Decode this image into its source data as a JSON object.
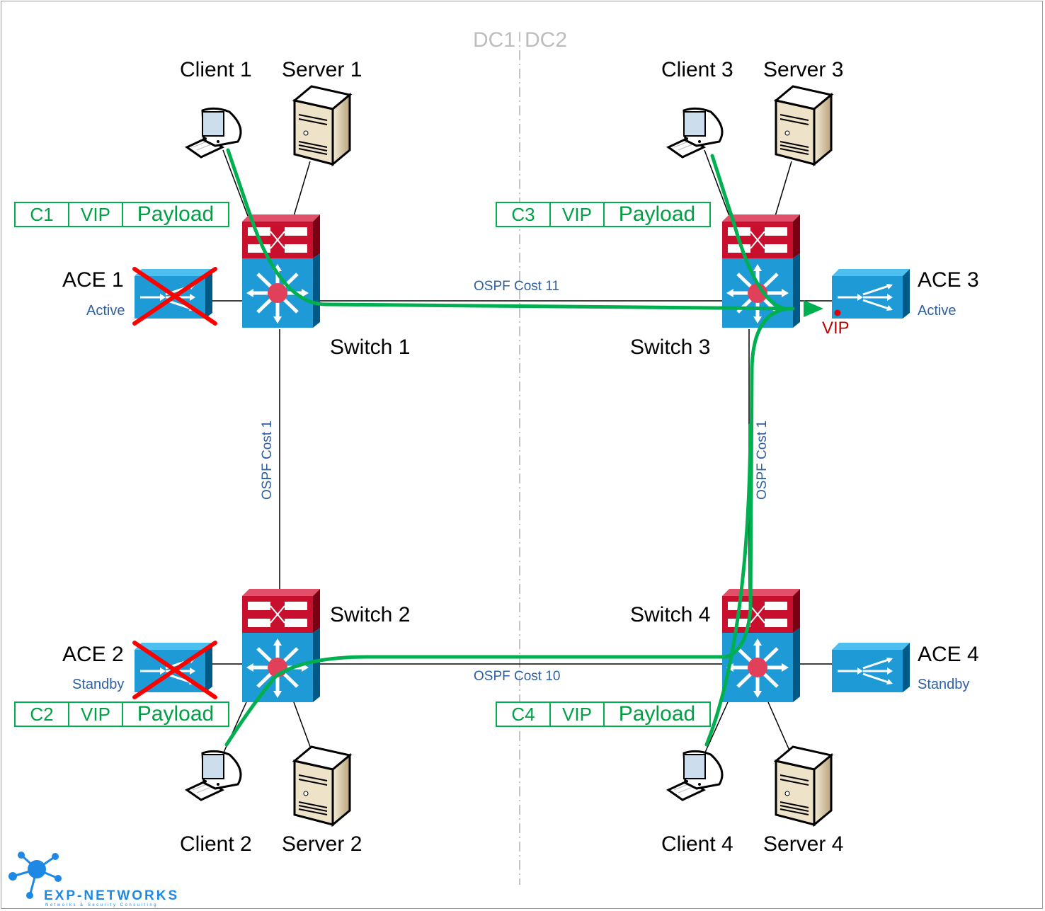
{
  "datacenters": {
    "left": "DC1",
    "right": "DC2"
  },
  "nodes": {
    "client1": "Client 1",
    "server1": "Server 1",
    "client2": "Client 2",
    "server2": "Server 2",
    "client3": "Client 3",
    "server3": "Server 3",
    "client4": "Client 4",
    "server4": "Server 4",
    "switch1": "Switch 1",
    "switch2": "Switch 2",
    "switch3": "Switch 3",
    "switch4": "Switch 4"
  },
  "ace": [
    {
      "name": "ACE 1",
      "state": "Active",
      "failed": true
    },
    {
      "name": "ACE 2",
      "state": "Standby",
      "failed": true
    },
    {
      "name": "ACE 3",
      "state": "Active",
      "failed": false
    },
    {
      "name": "ACE 4",
      "state": "Standby",
      "failed": false
    }
  ],
  "vip_label": "VIP",
  "links": {
    "sw1_sw3": "OSPF Cost 11",
    "sw2_sw4": "OSPF Cost 10",
    "sw1_sw2": "OSPF Cost 1",
    "sw3_sw4": "OSPF Cost 1"
  },
  "packets": [
    {
      "src": "C1",
      "dst": "VIP",
      "payload": "Payload"
    },
    {
      "src": "C2",
      "dst": "VIP",
      "payload": "Payload"
    },
    {
      "src": "C3",
      "dst": "VIP",
      "payload": "Payload"
    },
    {
      "src": "C4",
      "dst": "VIP",
      "payload": "Payload"
    }
  ],
  "logo": {
    "name": "EXP-NETWORKS",
    "tagline": "Networks & Security Consulting"
  },
  "colors": {
    "flow": "#00b050",
    "fail": "#ff0000",
    "vip": "#c00000",
    "ospf": "#2e5fa3",
    "switch_top": "#c8102e",
    "switch_body": "#1e9ad6",
    "ace": "#1e9ad6"
  }
}
